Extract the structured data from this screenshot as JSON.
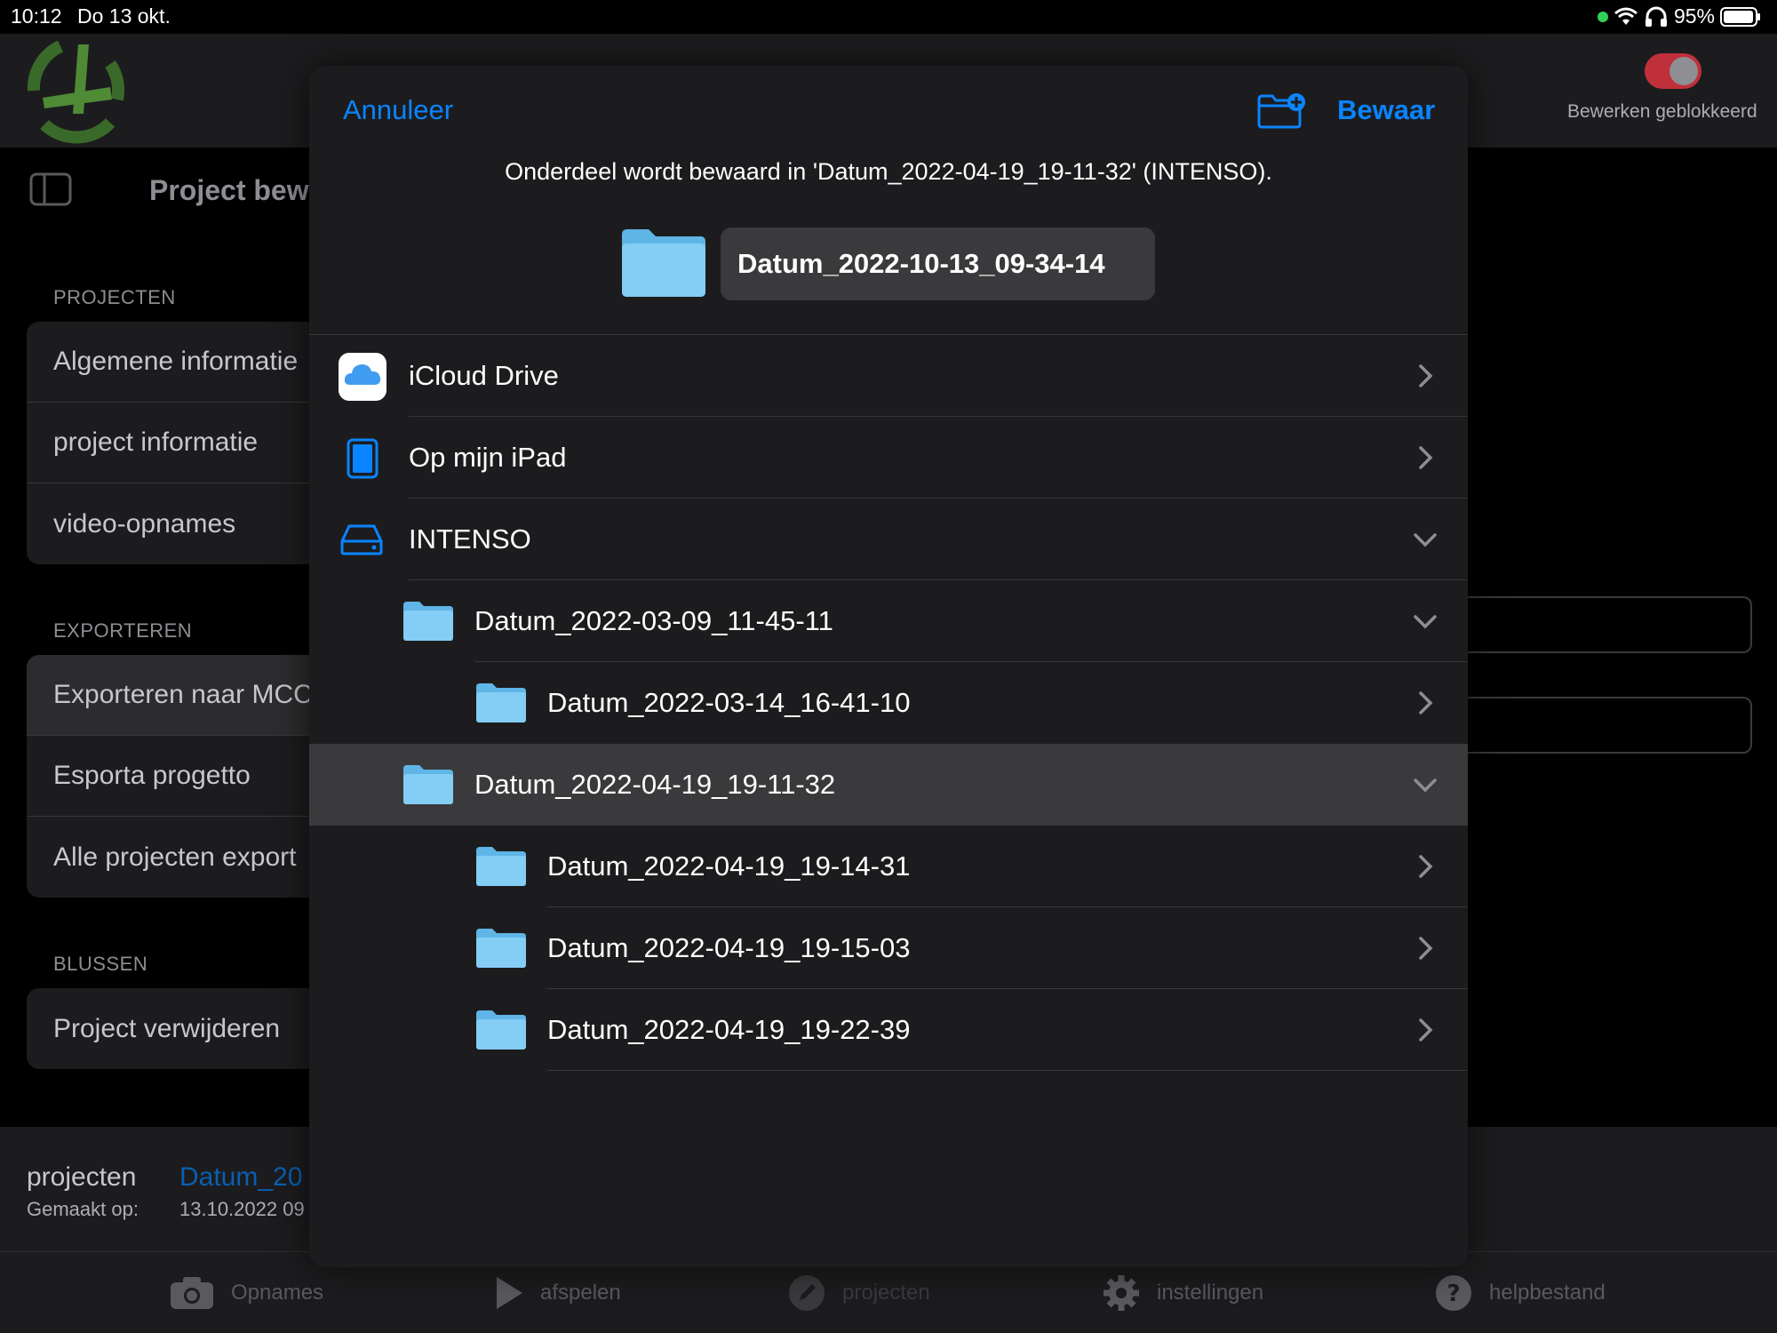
{
  "status_bar": {
    "time": "10:12",
    "date": "Do 13 okt.",
    "battery": "95%"
  },
  "header": {
    "toggle_label": "Bewerken geblokkeerd",
    "title": "Project bewe"
  },
  "sidebar": {
    "sections": [
      {
        "label": "PROJECTEN",
        "items": [
          "Algemene informatie",
          "project informatie",
          "video-opnames"
        ]
      },
      {
        "label": "EXPORTEREN",
        "items": [
          "Exporteren naar MCC",
          "Esporta progetto",
          "Alle projecten export"
        ]
      },
      {
        "label": "BLUSSEN",
        "items": [
          "Project verwijderen"
        ]
      }
    ]
  },
  "bottom_info": {
    "label": "projecten",
    "value": "Datum_20",
    "created_label": "Gemaakt op:",
    "created_value": "13.10.2022 09"
  },
  "tabbar": {
    "tabs": [
      {
        "label": "Opnames",
        "icon": "camera-icon"
      },
      {
        "label": "afspelen",
        "icon": "play-icon"
      },
      {
        "label": "projecten",
        "icon": "pencil-icon"
      },
      {
        "label": "instellingen",
        "icon": "gear-icon"
      },
      {
        "label": "helpbestand",
        "icon": "help-icon"
      }
    ]
  },
  "dialog": {
    "cancel_label": "Annuleer",
    "save_label": "Bewaar",
    "message": "Onderdeel wordt bewaard in 'Datum_2022-04-19_19-11-32' (INTENSO).",
    "filename": "Datum_2022-10-13_09-34-14",
    "locations": [
      {
        "label": "iCloud Drive",
        "icon": "icloud-icon",
        "expanded": false
      },
      {
        "label": "Op mijn iPad",
        "icon": "ipad-icon",
        "expanded": false
      },
      {
        "label": "INTENSO",
        "icon": "drive-icon",
        "expanded": true
      }
    ],
    "folders": [
      {
        "label": "Datum_2022-03-09_11-45-11",
        "level": 1,
        "expanded": true,
        "selected": false
      },
      {
        "label": "Datum_2022-03-14_16-41-10",
        "level": 2,
        "expanded": false,
        "selected": false
      },
      {
        "label": "Datum_2022-04-19_19-11-32",
        "level": 1,
        "expanded": true,
        "selected": true
      },
      {
        "label": "Datum_2022-04-19_19-14-31",
        "level": 2,
        "expanded": false,
        "selected": false
      },
      {
        "label": "Datum_2022-04-19_19-15-03",
        "level": 2,
        "expanded": false,
        "selected": false
      },
      {
        "label": "Datum_2022-04-19_19-22-39",
        "level": 2,
        "expanded": false,
        "selected": false
      }
    ]
  },
  "colors": {
    "accent": "#0a84ff",
    "toggle_off": "#c0303a",
    "modal_bg": "#1c1c1e",
    "selected_row": "#3a3a3c",
    "folder": "#6bc4f2"
  }
}
